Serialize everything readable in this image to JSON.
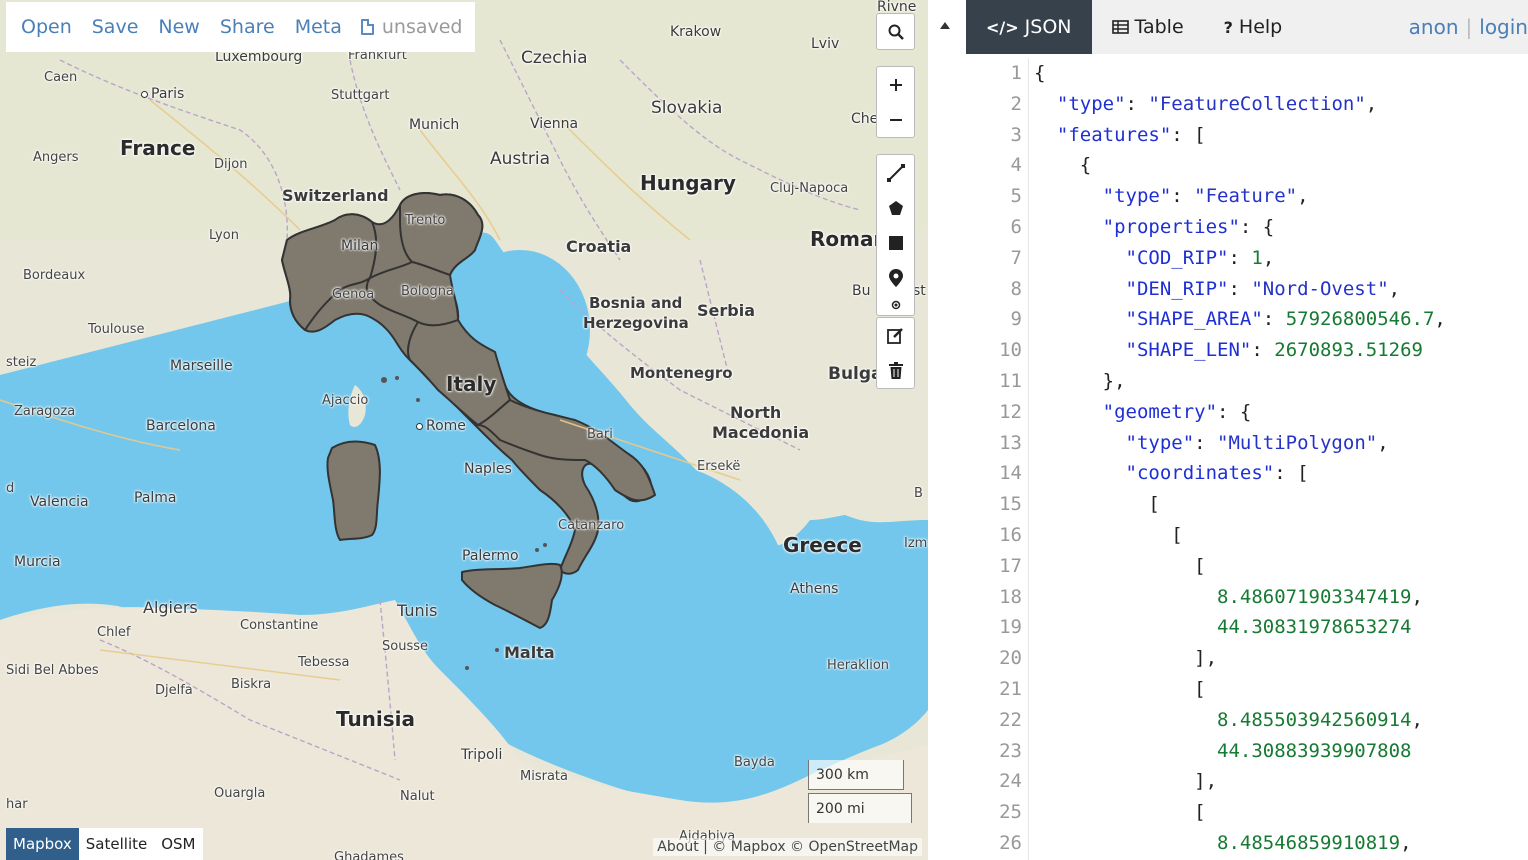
{
  "menu": {
    "open": "Open",
    "save": "Save",
    "new": "New",
    "share": "Share",
    "meta": "Meta",
    "unsaved": "unsaved"
  },
  "map": {
    "labels": {
      "rivne": "Rivne",
      "krakow": "Krakow",
      "lviv": "Lviv",
      "luxembourg": "Luxembourg",
      "frankfurt": "Frankfurt",
      "czechia": "Czechia",
      "caen": "Caen",
      "paris": "Paris",
      "stuttgart": "Stuttgart",
      "slovakia": "Slovakia",
      "munich": "Munich",
      "vienna": "Vienna",
      "che": "Che",
      "angers": "Angers",
      "france": "France",
      "austria": "Austria",
      "dijon": "Dijon",
      "hungary": "Hungary",
      "clujnapoca": "Cluj-Napoca",
      "switzerland": "Switzerland",
      "trento": "Trento",
      "lyon": "Lyon",
      "milan": "Milan",
      "croatia": "Croatia",
      "roman": "Roman",
      "bordeaux": "Bordeaux",
      "genoa": "Genoa",
      "bologna": "Bologna",
      "bosnia": "Bosnia and",
      "herzegovina": "Herzegovina",
      "serbia": "Serbia",
      "bu": "Bu",
      "st": "st",
      "toulouse": "Toulouse",
      "steiz": "steiz",
      "marseille": "Marseille",
      "italy": "Italy",
      "montenegro": "Montenegro",
      "bulga": "Bulga",
      "ajaccio": "Ajaccio",
      "zaragoza": "Zaragoza",
      "barcelona": "Barcelona",
      "rome": "Rome",
      "north": "North",
      "macedonia": "Macedonia",
      "bari": "Bari",
      "naples": "Naples",
      "erseke": "Ersekë",
      "valencia": "Valencia",
      "palma": "Palma",
      "d": "d",
      "b": "B",
      "catanzaro": "Catanzaro",
      "greece": "Greece",
      "izm": "Izm",
      "palermo": "Palermo",
      "murcia": "Murcia",
      "athens": "Athens",
      "algiers": "Algiers",
      "tunis": "Tunis",
      "chlef": "Chlef",
      "constantine": "Constantine",
      "sousse": "Sousse",
      "malta": "Malta",
      "tebessa": "Tebessa",
      "heraklion": "Heraklion",
      "sidibelabbes": "Sidi Bel Abbes",
      "djelfa": "Djelfa",
      "biskra": "Biskra",
      "tunisia": "Tunisia",
      "tripoli": "Tripoli",
      "bayda": "Bayda",
      "misrata": "Misrata",
      "ouargla": "Ouargla",
      "nalut": "Nalut",
      "har": "har",
      "ajdabiya": "Ajdabiya",
      "ghadames": "Ghadames"
    },
    "scale_km": "300 km",
    "scale_mi": "200 mi",
    "attribution": "About | © Mapbox © OpenStreetMap",
    "layers": [
      "Mapbox",
      "Satellite",
      "OSM"
    ],
    "active_layer": "Mapbox",
    "colors": {
      "sea": "#73c7ec",
      "land": "#e8e6d6",
      "polygon_fill": "#807a6e",
      "polygon_stroke": "#333333"
    }
  },
  "tabs": {
    "json": "JSON",
    "table": "Table",
    "help": "Help",
    "active": "json"
  },
  "auth": {
    "anon": "anon",
    "sep": "|",
    "login": "login"
  },
  "editor": {
    "line_numbers": [
      "1",
      "2",
      "3",
      "4",
      "5",
      "6",
      "7",
      "8",
      "9",
      "10",
      "11",
      "12",
      "13",
      "14",
      "15",
      "16",
      "17",
      "18",
      "19",
      "20",
      "21",
      "22",
      "23",
      "24",
      "25",
      "26"
    ],
    "l1": "{",
    "l2_key": "\"type\"",
    "l2_val": "\"FeatureCollection\"",
    "l3_key": "\"features\"",
    "l3_rest": ": [",
    "l4": "{",
    "l5_key": "\"type\"",
    "l5_val": "\"Feature\"",
    "l6_key": "\"properties\"",
    "l6_rest": ": {",
    "l7_key": "\"COD_RIP\"",
    "l7_val": "1",
    "l8_key": "\"DEN_RIP\"",
    "l8_val": "\"Nord-Ovest\"",
    "l9_key": "\"SHAPE_AREA\"",
    "l9_val": "57926800546.7",
    "l10_key": "\"SHAPE_LEN\"",
    "l10_val": "2670893.51269",
    "l11": "},",
    "l12_key": "\"geometry\"",
    "l12_rest": ": {",
    "l13_key": "\"type\"",
    "l13_val": "\"MultiPolygon\"",
    "l14_key": "\"coordinates\"",
    "l14_rest": ": [",
    "l15": "[",
    "l16": "[",
    "l17": "[",
    "l18": "8.486071903347419",
    "l19": "44.30831978653274",
    "l20": "],",
    "l21": "[",
    "l22": "8.485503942560914",
    "l23": "44.30883939907808",
    "l24": "],",
    "l25": "[",
    "l26": "8.48546859910819"
  }
}
